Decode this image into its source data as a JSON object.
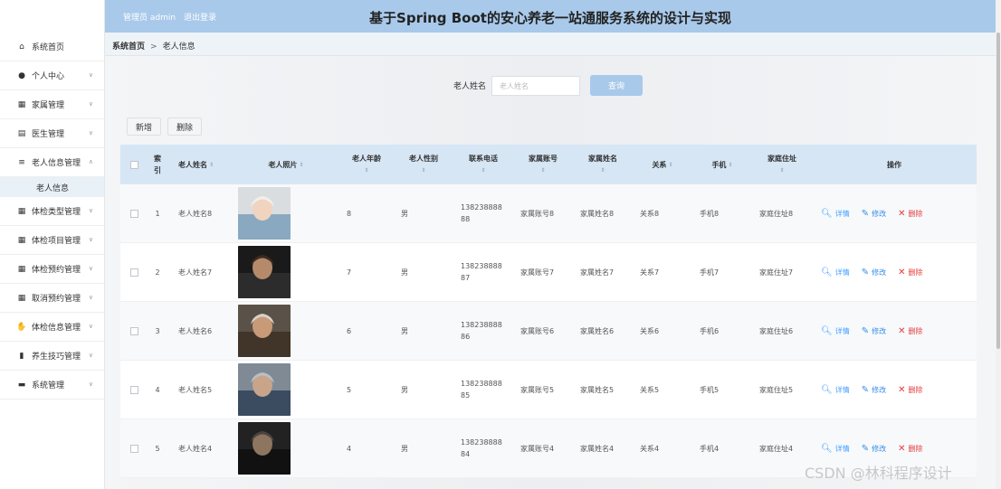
{
  "header": {
    "user_role": "管理员 admin",
    "logout": "退出登录",
    "title": "基于Spring Boot的安心养老一站通服务系统的设计与实现"
  },
  "breadcrumb": {
    "home": "系统首页",
    "separator": ">",
    "current": "老人信息"
  },
  "sidebar": {
    "items": [
      {
        "label": "系统首页",
        "icon": "home-icon",
        "chev": ""
      },
      {
        "label": "个人中心",
        "icon": "user-icon",
        "chev": "∨"
      },
      {
        "label": "家属管理",
        "icon": "grid-icon",
        "chev": "∨"
      },
      {
        "label": "医生管理",
        "icon": "clipboard-icon",
        "chev": "∨"
      },
      {
        "label": "老人信息管理",
        "icon": "list-icon",
        "chev": "∧"
      },
      {
        "label": "体检类型管理",
        "icon": "grid-icon",
        "chev": "∨"
      },
      {
        "label": "体检项目管理",
        "icon": "grid-icon",
        "chev": "∨"
      },
      {
        "label": "体检预约管理",
        "icon": "grid-icon",
        "chev": "∨"
      },
      {
        "label": "取消预约管理",
        "icon": "grid-icon",
        "chev": "∨"
      },
      {
        "label": "体检信息管理",
        "icon": "thumb-icon",
        "chev": "∨"
      },
      {
        "label": "养生技巧管理",
        "icon": "bar-chart-icon",
        "chev": "∨"
      },
      {
        "label": "系统管理",
        "icon": "briefcase-icon",
        "chev": "∨"
      }
    ],
    "sub_item": "老人信息"
  },
  "search": {
    "label": "老人姓名",
    "placeholder": "老人姓名",
    "button": "查询"
  },
  "toolbar": {
    "add": "新增",
    "delete": "删除"
  },
  "table": {
    "headers": {
      "index": "索\n引",
      "name": "老人姓名",
      "photo": "老人照片",
      "age": "老人年龄",
      "gender": "老人性别",
      "phone": "联系电话",
      "family_account": "家属账号",
      "family_name": "家属姓名",
      "relation": "关系",
      "mobile": "手机",
      "address": "家庭住址",
      "ops": "操作"
    },
    "rows": [
      {
        "index": "1",
        "name": "老人姓名8",
        "age": "8",
        "gender": "男",
        "phone": "138238888\n88",
        "family_account": "家属账号8",
        "family_name": "家属姓名8",
        "relation": "关系8",
        "mobile": "手机8",
        "address": "家庭住址8"
      },
      {
        "index": "2",
        "name": "老人姓名7",
        "age": "7",
        "gender": "男",
        "phone": "138238888\n87",
        "family_account": "家属账号7",
        "family_name": "家属姓名7",
        "relation": "关系7",
        "mobile": "手机7",
        "address": "家庭住址7"
      },
      {
        "index": "3",
        "name": "老人姓名6",
        "age": "6",
        "gender": "男",
        "phone": "138238888\n86",
        "family_account": "家属账号6",
        "family_name": "家属姓名6",
        "relation": "关系6",
        "mobile": "手机6",
        "address": "家庭住址6"
      },
      {
        "index": "4",
        "name": "老人姓名5",
        "age": "5",
        "gender": "男",
        "phone": "138238888\n85",
        "family_account": "家属账号5",
        "family_name": "家属姓名5",
        "relation": "关系5",
        "mobile": "手机5",
        "address": "家庭住址5"
      },
      {
        "index": "5",
        "name": "老人姓名4",
        "age": "4",
        "gender": "男",
        "phone": "138238888\n84",
        "family_account": "家属账号4",
        "family_name": "家属姓名4",
        "relation": "关系4",
        "mobile": "手机4",
        "address": "家庭住址4"
      }
    ],
    "ops": {
      "detail": "详情",
      "edit": "修改",
      "delete": "删除"
    }
  },
  "watermark": "CSDN @林科程序设计",
  "colors": {
    "header_bg": "#a8c9ea",
    "table_header_bg": "#d6e6f5",
    "detail": "#409eff",
    "delete": "#e63a3a"
  }
}
